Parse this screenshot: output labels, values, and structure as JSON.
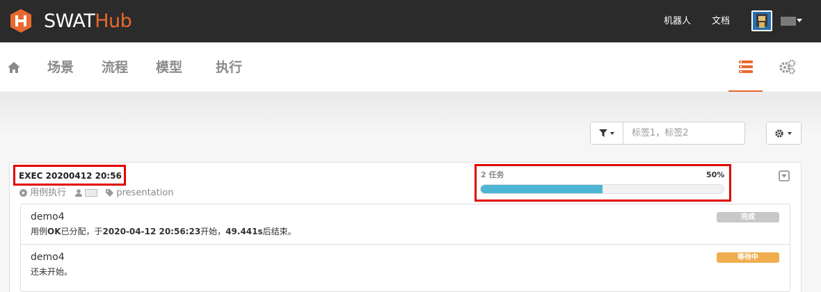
{
  "header": {
    "brand_prefix": "SWAT",
    "brand_suffix": "Hub",
    "links": [
      "机器人",
      "文档"
    ],
    "logo_color": "#e8692e"
  },
  "nav": {
    "home_icon": "home-icon",
    "items": [
      "场景",
      "流程",
      "模型",
      "执行"
    ],
    "right_icons": [
      "list-icon",
      "cogs-icon"
    ],
    "active_color": "#e8692e"
  },
  "toolbar": {
    "filter_icon": "filter-icon",
    "tag_placeholder": "标签1，标签2",
    "settings_icon": "gear-icon"
  },
  "execution": {
    "title": "EXEC 20200412 20:56",
    "type": "用例执行",
    "tag": "presentation",
    "task_label": "2 任务",
    "progress_percent": "50%",
    "progress_value": 0.5,
    "progress_color": "#4eb6d5",
    "tasks": [
      {
        "name": "demo4",
        "desc_pre": "用例",
        "desc_status": "OK",
        "desc_mid": "已分配，于",
        "desc_time": "2020-04-12 20:56:23",
        "desc_mid2": "开始，",
        "desc_duration": "49.441s",
        "desc_post": "后结束。",
        "status": "完成",
        "status_color": "#c8c8c8"
      },
      {
        "name": "demo4",
        "desc": "还未开始。",
        "status": "等待中",
        "status_color": "#f0ad4e"
      }
    ]
  }
}
